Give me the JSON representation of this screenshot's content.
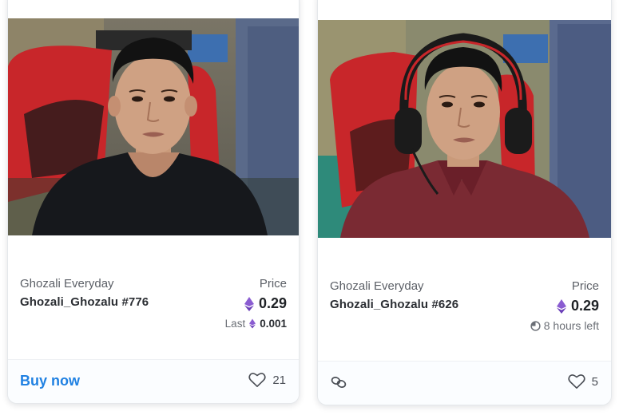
{
  "cards": [
    {
      "collection": "Ghozali Everyday",
      "name": "Ghozali_Ghozalu #776",
      "price_label": "Price",
      "price": "0.29",
      "last_label": "Last",
      "last_price": "0.001",
      "footer_action": "Buy now",
      "likes": "21",
      "shirt_color": "#16181c"
    },
    {
      "collection": "Ghozali Everyday",
      "name": "Ghozali_Ghozalu #626",
      "price_label": "Price",
      "price": "0.29",
      "time_left": "8 hours left",
      "likes": "5",
      "shirt_color": "#7a2a33"
    }
  ],
  "colors": {
    "accent": "#2081e2",
    "eth": "#8a5cd1"
  }
}
